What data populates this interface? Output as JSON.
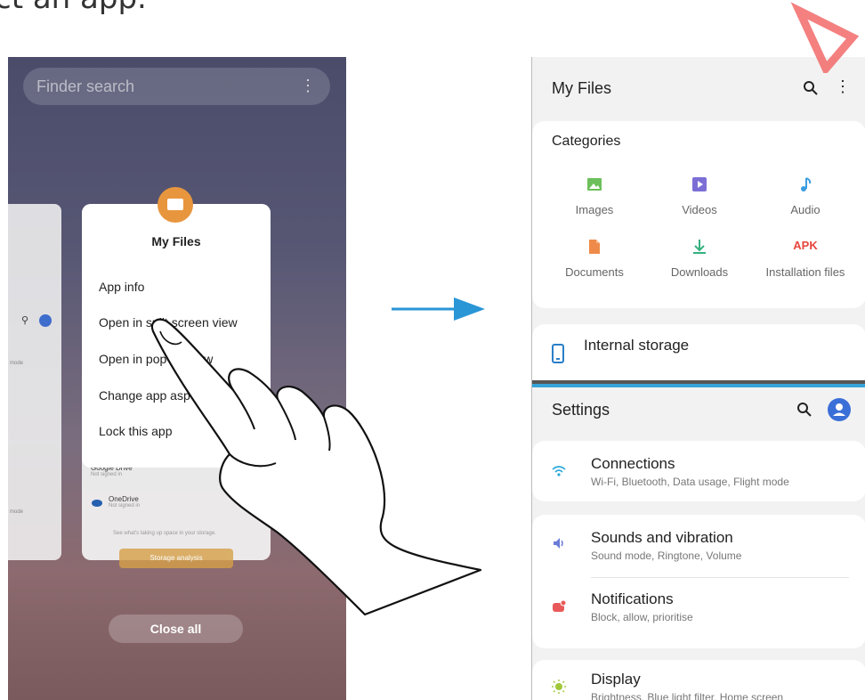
{
  "heading": "ct an app.",
  "left_phone": {
    "search": {
      "placeholder": "Finder search",
      "more_icon": "more-vertical-icon"
    },
    "app_name": "My Files",
    "menu": [
      "App info",
      "Open in split screen view",
      "Open in pop-up view",
      "Change app aspect ratio",
      "Lock this app"
    ],
    "background_card": {
      "rows": [
        {
          "title": "Google Drive",
          "sub": "Not signed in"
        },
        {
          "title": "OneDrive",
          "sub": "Not signed in"
        }
      ],
      "note": "See what's taking up space in your storage.",
      "button": "Storage analysis",
      "side_texts": [
        "mode",
        "mode",
        "mode"
      ]
    },
    "close_all": "Close all"
  },
  "right_phone": {
    "myfiles": {
      "title": "My Files",
      "categories_title": "Categories",
      "categories": [
        {
          "label": "Images",
          "icon": "image-icon",
          "color": "#6dbf5b"
        },
        {
          "label": "Videos",
          "icon": "video-icon",
          "color": "#7b6fd6"
        },
        {
          "label": "Audio",
          "icon": "music-note-icon",
          "color": "#3b9de0"
        },
        {
          "label": "Documents",
          "icon": "document-icon",
          "color": "#ef8b4a"
        },
        {
          "label": "Downloads",
          "icon": "download-icon",
          "color": "#35b07e"
        },
        {
          "label": "Installation files",
          "icon": "apk-icon",
          "icon_text": "APK",
          "color": "#e8453c"
        }
      ],
      "internal_storage": "Internal storage"
    },
    "settings": {
      "title": "Settings",
      "items": [
        {
          "title": "Connections",
          "sub": "Wi-Fi, Bluetooth, Data usage, Flight mode",
          "icon": "wifi-icon",
          "color": "#2aa8d8"
        },
        {
          "title": "Sounds and vibration",
          "sub": "Sound mode, Ringtone, Volume",
          "icon": "volume-icon",
          "color": "#6a7bd8"
        },
        {
          "title": "Notifications",
          "sub": "Block, allow, prioritise",
          "icon": "notification-icon",
          "color": "#e85a5a"
        },
        {
          "title": "Display",
          "sub": "Brightness, Blue light filter, Home screen",
          "icon": "brightness-icon",
          "color": "#a0c83a"
        }
      ]
    }
  },
  "colors": {
    "arrow": "#2a96d6",
    "split_divider": "#35a2d8",
    "settings_avatar": "#3b6fd8"
  }
}
